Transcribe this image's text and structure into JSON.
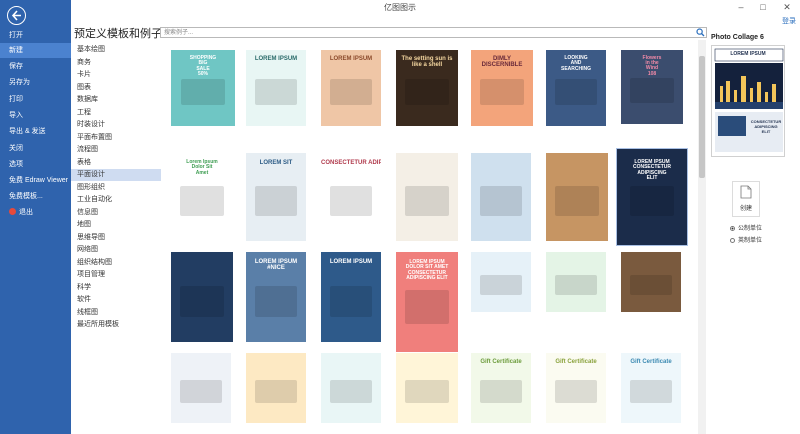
{
  "window": {
    "title": "亿图图示",
    "login": "登录"
  },
  "sidebar": {
    "items": [
      {
        "label": "打开",
        "active": false
      },
      {
        "label": "新建",
        "active": true
      },
      {
        "label": "保存",
        "active": false
      },
      {
        "label": "另存为",
        "active": false
      },
      {
        "label": "打印",
        "active": false
      },
      {
        "label": "导入",
        "active": false
      },
      {
        "label": "导出 & 发送",
        "active": false
      },
      {
        "label": "关闭",
        "active": false
      },
      {
        "label": "选项",
        "active": false
      },
      {
        "label": "免费 Edraw Viewer",
        "active": false
      },
      {
        "label": "免费模板...",
        "active": false
      },
      {
        "label": "退出",
        "active": false
      }
    ]
  },
  "main": {
    "title": "预定义模板和例子",
    "search_placeholder": "搜索例子..."
  },
  "categories": [
    "基本绘图",
    "商务",
    "卡片",
    "图表",
    "数据库",
    "工程",
    "时装设计",
    "平面布置图",
    "流程图",
    "表格",
    "平面设计",
    "图形组织",
    "工业自动化",
    "信息图",
    "地图",
    "思维导图",
    "网络图",
    "组织结构图",
    "项目管理",
    "科学",
    "软件",
    "线框图",
    "最近所用模板"
  ],
  "active_category": "平面设计",
  "thumbnails": [
    {
      "lines": [
        "SHOPPING",
        "BIG",
        "SALE",
        "50%"
      ],
      "bg": "#6fc6c4",
      "fg": "#ffffff"
    },
    {
      "lines": [
        "LOREM IPSUM"
      ],
      "bg": "#e8f6f4",
      "fg": "#2a6b6a"
    },
    {
      "lines": [
        "LOREM IPSUM"
      ],
      "bg": "#efc6a6",
      "fg": "#8b4a2b"
    },
    {
      "lines": [
        "The setting sun is",
        "like a shell"
      ],
      "bg": "#3a2a1e",
      "fg": "#f5d7a0"
    },
    {
      "lines": [
        "DIMLY",
        "DISCERNIBLE"
      ],
      "bg": "#f3a47b",
      "fg": "#6a2a3a"
    },
    {
      "lines": [
        "LOOKING",
        "AND",
        "SEARCHING"
      ],
      "bg": "#3c5a86",
      "fg": "#ffffff"
    },
    {
      "lines": [
        "Flowers",
        "in the",
        "Wind",
        "108"
      ],
      "bg": "#3b4d6e",
      "fg": "#f28aa8"
    },
    {
      "lines": [
        "Lorem Ipsum",
        "Dolor Sit",
        "Amet"
      ],
      "bg": "#ffffff",
      "fg": "#3e9d52"
    },
    {
      "lines": [
        "LOREM SIT"
      ],
      "bg": "#e7eef3",
      "fg": "#2d5c86"
    },
    {
      "lines": [
        "CONSECTETUR ADIPISCING ELIT"
      ],
      "bg": "#ffffff",
      "fg": "#b03a4c"
    },
    {
      "lines": [
        ""
      ],
      "bg": "#f4efe6",
      "fg": "#666666"
    },
    {
      "lines": [
        ""
      ],
      "bg": "#cfe0ee",
      "fg": "#2d5c86"
    },
    {
      "lines": [
        ""
      ],
      "bg": "#c69563",
      "fg": "#ffffff"
    },
    {
      "lines": [
        "LOREM IPSUM",
        "CONSECTETUR",
        "ADIPISCING",
        "ELIT"
      ],
      "bg": "#1b2c4a",
      "fg": "#ffffff"
    },
    {
      "lines": [
        ""
      ],
      "bg": "#223d62",
      "fg": "#ffffff"
    },
    {
      "lines": [
        "LOREM IPSUM",
        "#NICE"
      ],
      "bg": "#5a7fa8",
      "fg": "#ffffff"
    },
    {
      "lines": [
        "LOREM IPSUM"
      ],
      "bg": "#2e5a8a",
      "fg": "#ffffff"
    },
    {
      "lines": [
        "LOREM IPSUM",
        "DOLOR SIT AMET",
        "CONSECTETUR",
        "ADIPISCING ELIT"
      ],
      "bg": "#f07f7c",
      "fg": "#ffffff"
    },
    {
      "lines": [
        ""
      ],
      "bg": "#e6f1f8",
      "fg": "#2d6ba8"
    },
    {
      "lines": [
        ""
      ],
      "bg": "#e4f4e6",
      "fg": "#3b8e4a"
    },
    {
      "lines": [
        ""
      ],
      "bg": "#7a5a3e",
      "fg": "#ffffff"
    },
    {
      "lines": [
        ""
      ],
      "bg": "#eef2f7",
      "fg": "#3c5a86"
    },
    {
      "lines": [
        ""
      ],
      "bg": "#fde9c3",
      "fg": "#c98324"
    },
    {
      "lines": [
        ""
      ],
      "bg": "#e9f6f6",
      "fg": "#2a8a8a"
    },
    {
      "lines": [
        ""
      ],
      "bg": "#fff5d8",
      "fg": "#d89b1f"
    },
    {
      "lines": [
        "Gift Certificate"
      ],
      "bg": "#f2f9e9",
      "fg": "#6c9c3c"
    },
    {
      "lines": [
        "Gift Certificate"
      ],
      "bg": "#fbfbf1",
      "fg": "#8aa23c"
    },
    {
      "lines": [
        "Gift Certificate"
      ],
      "bg": "#eef7fb",
      "fg": "#3c8ab2"
    }
  ],
  "preview": {
    "title": "Photo Collage 6",
    "header": "LOREM IPSUM",
    "footer": [
      "CONSECTETUR",
      "ADIPISCING",
      "ELIT"
    ]
  },
  "actions": {
    "create_label": "创建",
    "units": [
      {
        "label": "公制单位",
        "selected": true
      },
      {
        "label": "英制单位",
        "selected": false
      }
    ]
  },
  "colors": {
    "sidebar": "#2f63ad",
    "sidebar_active": "#4b82cf",
    "category_active": "#cfdcf1"
  }
}
